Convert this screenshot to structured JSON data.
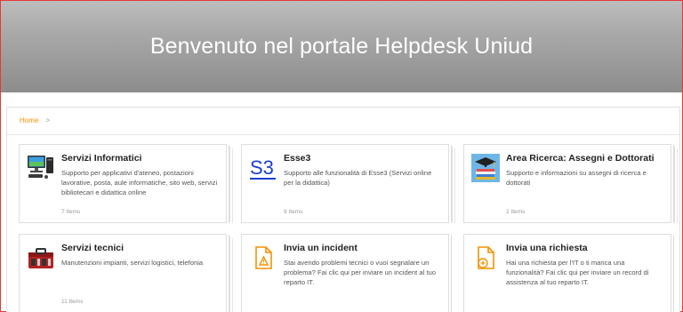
{
  "header": {
    "title": "Benvenuto nel portale Helpdesk Uniud"
  },
  "breadcrumb": {
    "home": "Home",
    "separator": ">"
  },
  "cards": [
    {
      "title": "Servizi Informatici",
      "desc": "Supporto per applicativi d'ateneo, postazioni lavorative, posta, aule informatiche, sito web, servizi bibliotecari e didattica online",
      "count": "7 Items",
      "icon": "computer-workstation-icon"
    },
    {
      "title": "Esse3",
      "desc": "Supporto alle funzionalità di Esse3 (Servizi online per la didattica)",
      "count": "9 Items",
      "icon": "s3-logo-icon",
      "icon_text": "S3"
    },
    {
      "title": "Area Ricerca: Assegni e Dottorati",
      "desc": "Supporto e informazioni su assegni di ricerca e dottorati",
      "count": "2 Items",
      "icon": "graduation-books-icon"
    },
    {
      "title": "Servizi tecnici",
      "desc": "Manutenzioni impianti, servizi logistici, telefonia",
      "count": "11 Items",
      "icon": "toolbox-icon"
    },
    {
      "title": "Invia un incident",
      "desc": "Stai avendo problemi tecnici o vuoi segnalare un problema? Fai clic qui per inviare un incident al tuo reparto IT.",
      "count": "",
      "icon": "incident-document-icon"
    },
    {
      "title": "Invia una richiesta",
      "desc": "Hai una richiesta per l'IT o ti manca una funzionalità? Fai clic qui per inviare un record di assistenza al tuo reparto IT.",
      "count": "",
      "icon": "request-document-icon"
    }
  ],
  "colors": {
    "accent": "#f39200",
    "frame": "#e53935",
    "s3_blue": "#1a3fcf"
  }
}
